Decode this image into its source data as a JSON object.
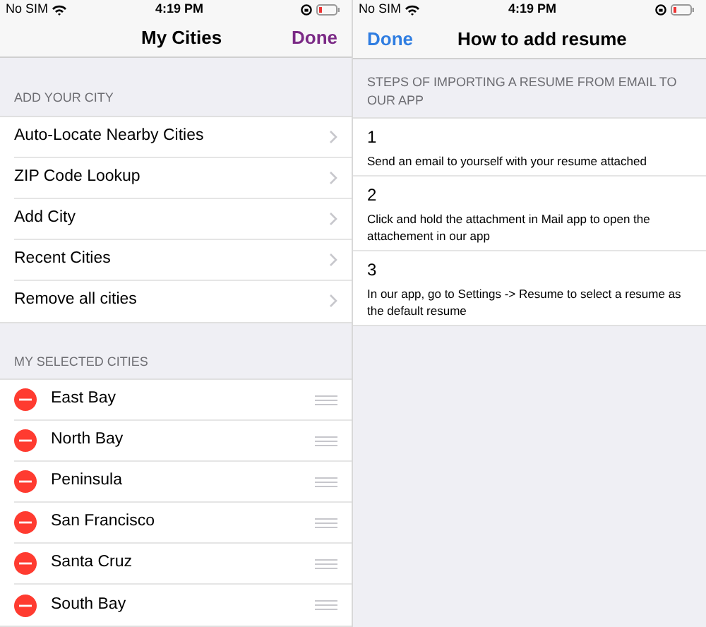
{
  "screens": [
    {
      "status_bar": {
        "carrier": "No SIM",
        "time": "4:19 PM"
      },
      "nav": {
        "title": "My Cities",
        "right_button": "Done"
      },
      "sections": [
        {
          "header": "ADD YOUR CITY",
          "kind": "disclosure",
          "items": [
            "Auto-Locate Nearby Cities",
            "ZIP Code Lookup",
            "Add City",
            "Recent Cities",
            "Remove all cities"
          ]
        },
        {
          "header": "MY SELECTED CITIES",
          "kind": "editable",
          "items": [
            "East Bay",
            "North Bay",
            "Peninsula",
            "San Francisco",
            "Santa Cruz",
            "South Bay"
          ]
        }
      ]
    },
    {
      "status_bar": {
        "carrier": "No SIM",
        "time": "4:19 PM"
      },
      "nav": {
        "title": "How to add resume",
        "left_button": "Done"
      },
      "sections": [
        {
          "header": "STEPS OF IMPORTING A RESUME FROM EMAIL TO OUR APP",
          "kind": "steps",
          "items": [
            {
              "number": "1",
              "text": "Send an email to yourself with your resume attached"
            },
            {
              "number": "2",
              "text": "Click and hold the attachment in Mail app to open the attachement in our app"
            },
            {
              "number": "3",
              "text": "In our app, go to Settings -> Resume to select a resume as the default resume"
            }
          ]
        }
      ]
    }
  ]
}
